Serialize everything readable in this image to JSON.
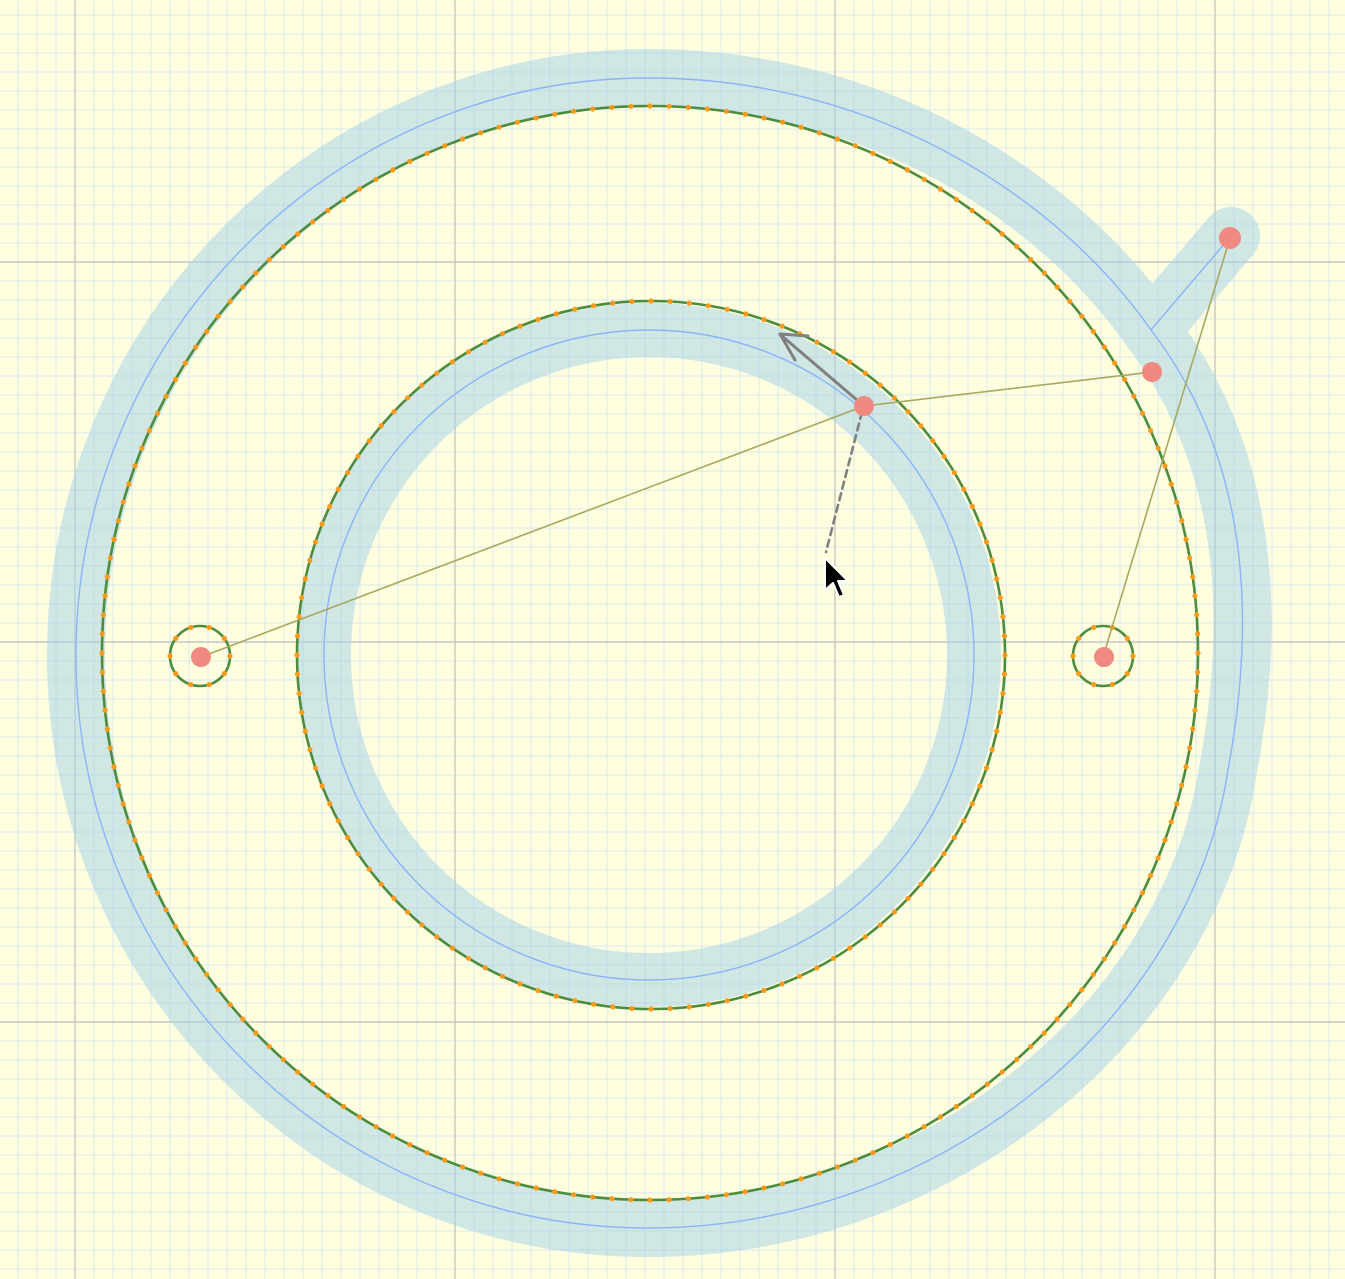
{
  "canvas": {
    "background": "#ffffe0",
    "grid_minor_color": "#d8e8ee",
    "grid_major_color": "#c6c6c6"
  },
  "shapes": {
    "stroke_halo_color": "#a9d4e8",
    "path_color": "#8ab4f8",
    "outline_color": "#4c8c3c",
    "vertex_dot_color": "#ff9a1a",
    "handle_color": "#f08a80",
    "guide_line_color": "#a8a860",
    "direction_arrow_color": "#808080"
  },
  "cursor": {
    "icon": "arrow-pointer-icon"
  }
}
